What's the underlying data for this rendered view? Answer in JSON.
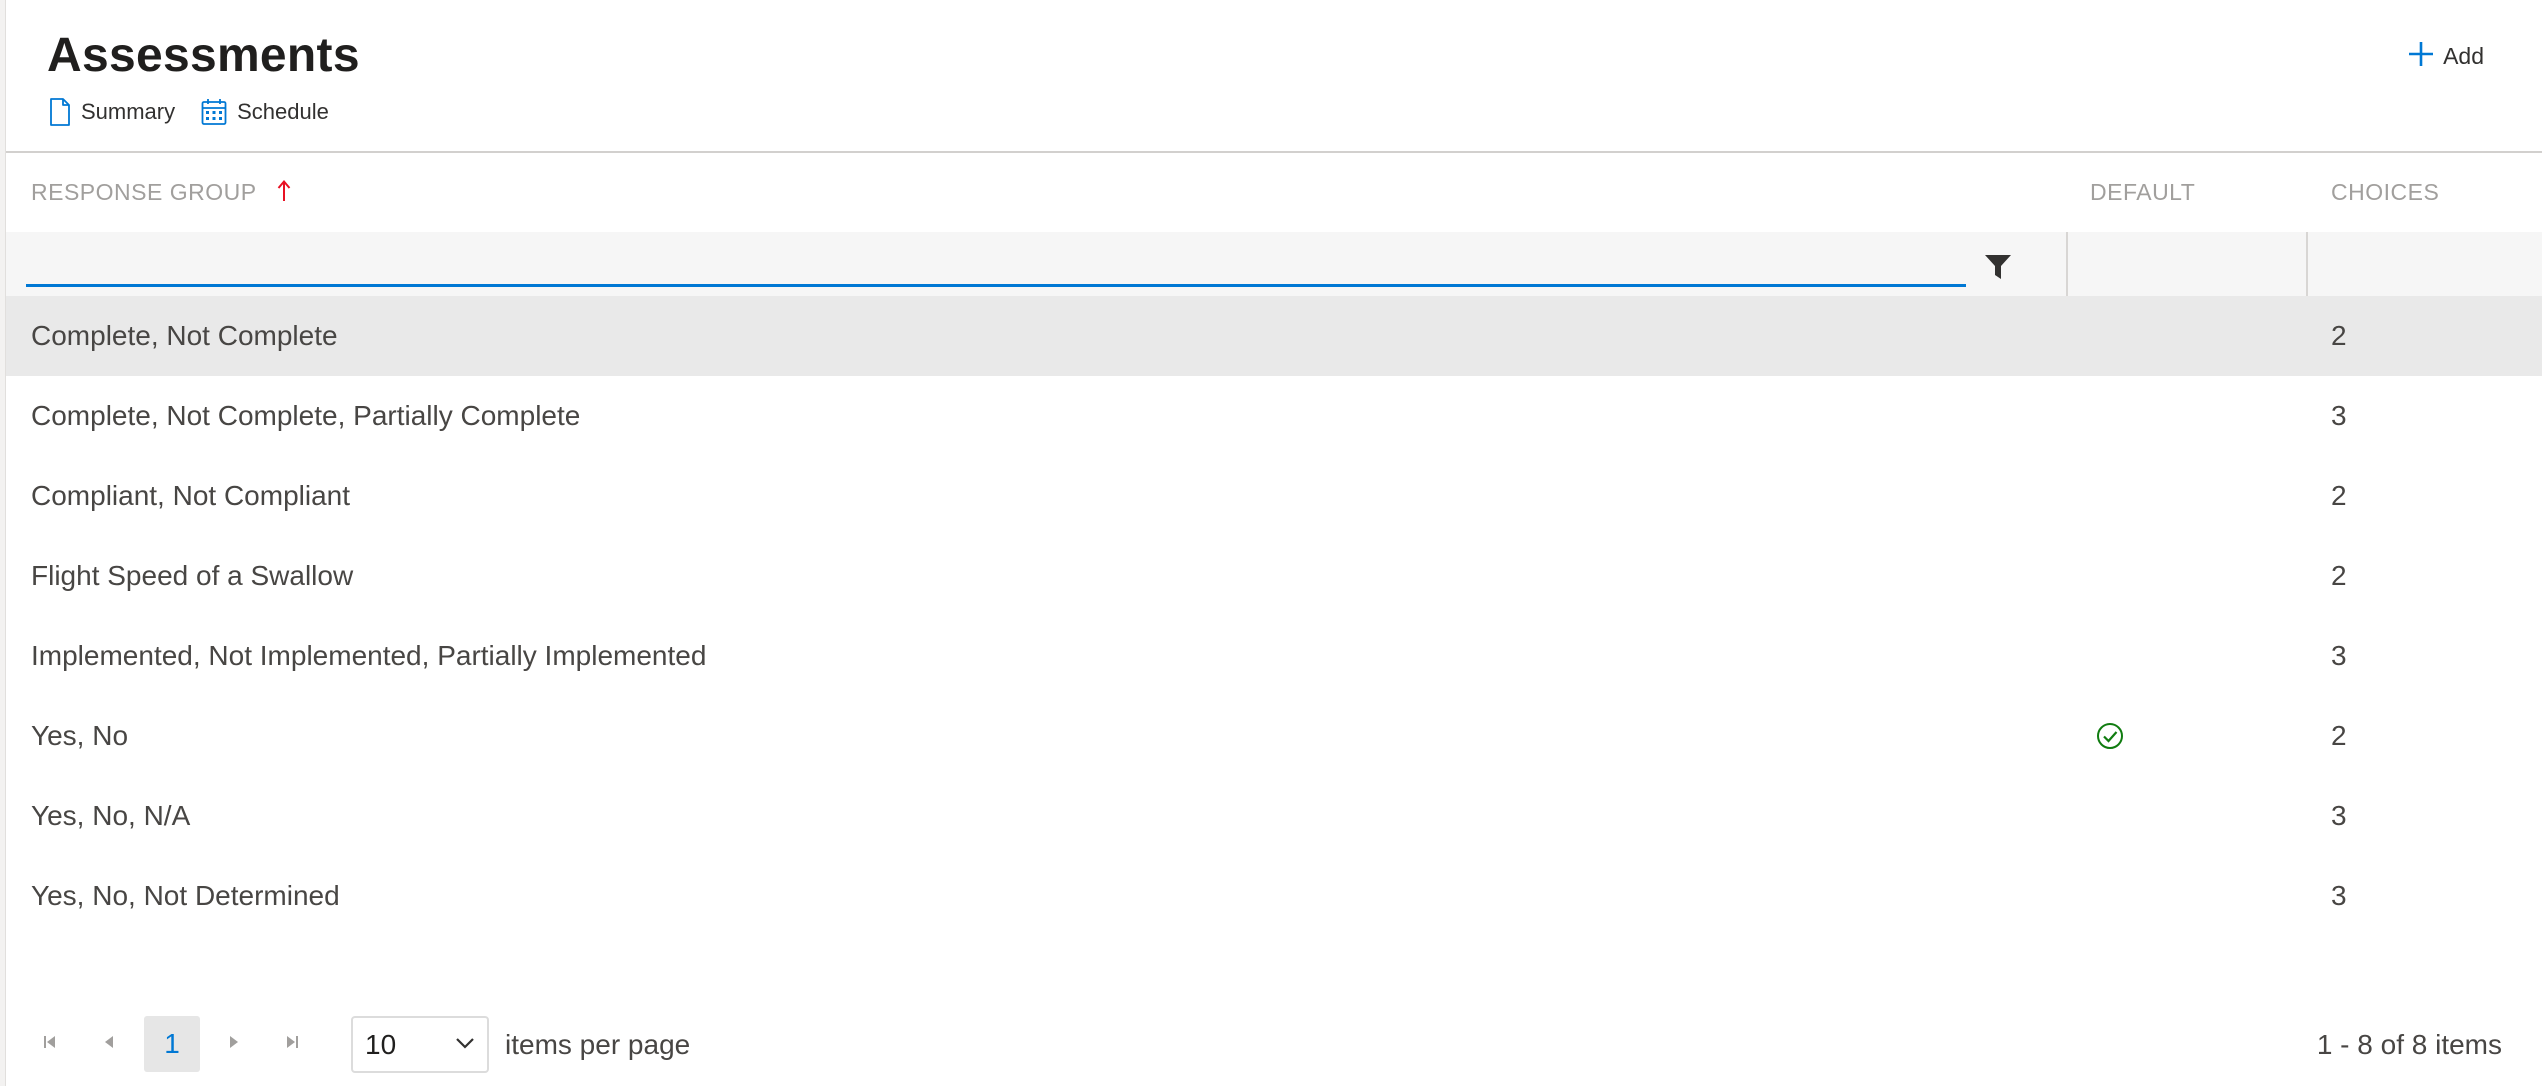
{
  "header": {
    "title": "Assessments",
    "links": [
      {
        "label": "Summary",
        "icon": "document-icon"
      },
      {
        "label": "Schedule",
        "icon": "calendar-icon"
      }
    ],
    "add_label": "Add"
  },
  "grid": {
    "columns": {
      "response_group": "RESPONSE GROUP",
      "default": "DEFAULT",
      "choices": "CHOICES"
    },
    "sort": {
      "column": "response_group",
      "direction": "ascending"
    },
    "filter": {
      "value": "",
      "placeholder": ""
    },
    "rows": [
      {
        "name": "Complete, Not Complete",
        "default": false,
        "choices": "2",
        "selected": true
      },
      {
        "name": "Complete, Not Complete, Partially Complete",
        "default": false,
        "choices": "3"
      },
      {
        "name": "Compliant, Not Compliant",
        "default": false,
        "choices": "2"
      },
      {
        "name": "Flight Speed of a Swallow",
        "default": false,
        "choices": "2"
      },
      {
        "name": "Implemented, Not Implemented, Partially Implemented",
        "default": false,
        "choices": "3"
      },
      {
        "name": "Yes, No",
        "default": true,
        "choices": "2"
      },
      {
        "name": "Yes, No, N/A",
        "default": false,
        "choices": "3"
      },
      {
        "name": "Yes, No, Not Determined",
        "default": false,
        "choices": "3"
      }
    ]
  },
  "pager": {
    "current_page": "1",
    "page_size": "10",
    "page_size_label": "items per page",
    "info": "1 - 8 of 8 items"
  },
  "colors": {
    "accent": "#0078d4",
    "sort_arrow": "#e81123",
    "default_check": "#107c10"
  }
}
